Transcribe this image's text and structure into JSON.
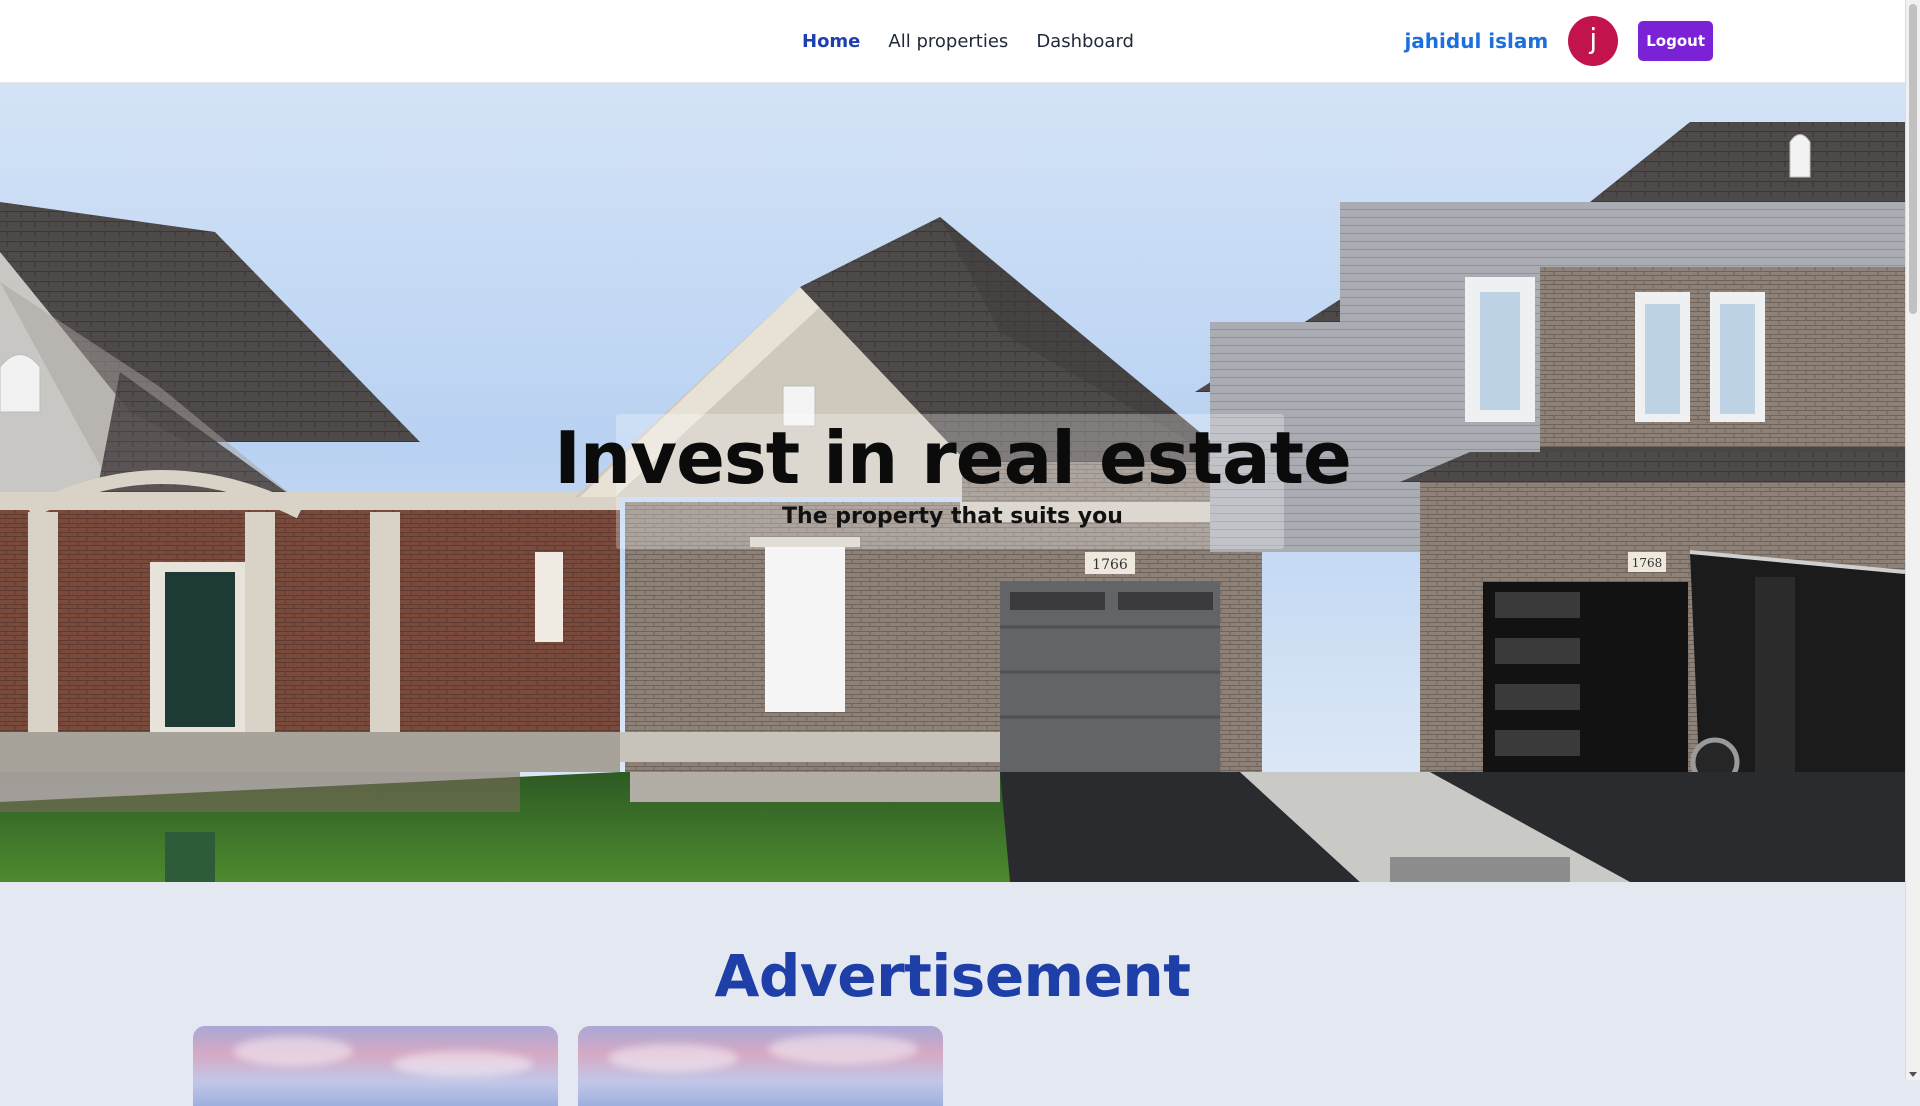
{
  "nav": {
    "links": [
      {
        "label": "Home",
        "active": true
      },
      {
        "label": "All properties",
        "active": false
      },
      {
        "label": "Dashboard",
        "active": false
      }
    ],
    "user": {
      "name": "jahidul islam",
      "avatar_initial": "j",
      "avatar_color": "#c3134c"
    },
    "logout_label": "Logout",
    "logout_color": "#7c22d6",
    "accent_color": "#1e40af"
  },
  "hero": {
    "title": "Invest in real estate",
    "subtitle": "The property that suits you",
    "house_number_left": "1766",
    "house_number_right": "1768"
  },
  "advertisement": {
    "heading": "Advertisement",
    "heading_color": "#1e3fa8",
    "cards_visible": 2
  }
}
